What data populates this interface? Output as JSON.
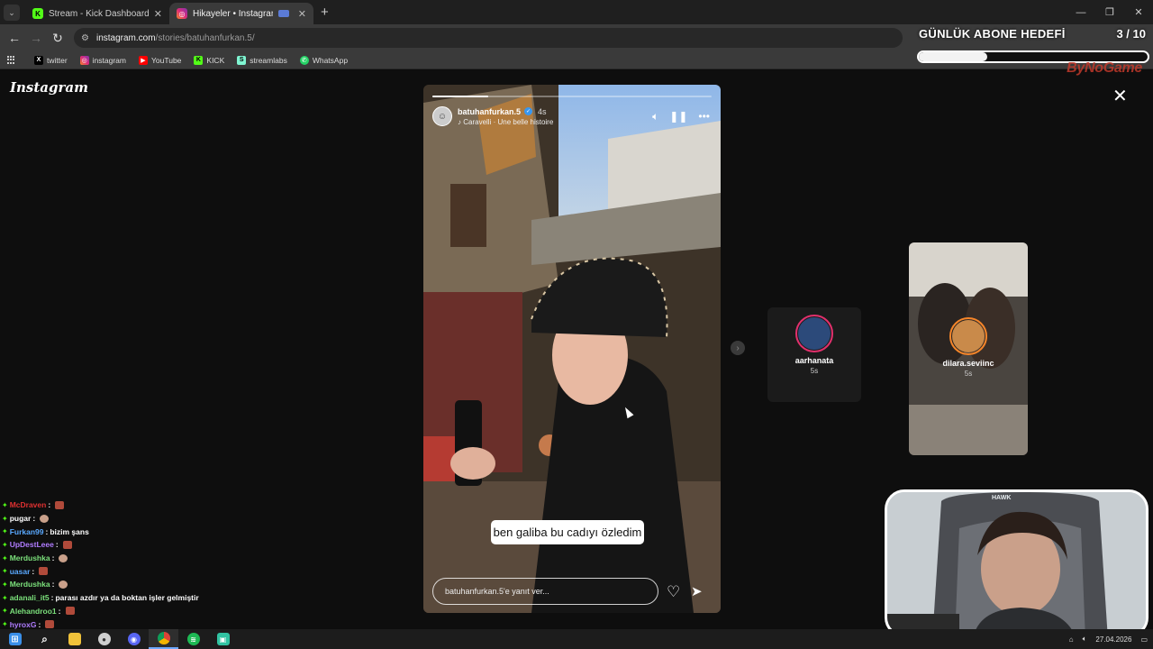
{
  "browser": {
    "tabs": [
      {
        "title": "Stream - Kick Dashboard",
        "active": false,
        "favicon": "kick-icon"
      },
      {
        "title": "Hikayeler • Instagram",
        "active": true,
        "favicon": "instagram-icon"
      }
    ],
    "url_host": "instagram.com",
    "url_path": "/stories/batuhanfurkan.5/",
    "bookmarks": [
      {
        "label": "twitter",
        "icon": "x-icon"
      },
      {
        "label": "instagram",
        "icon": "instagram-icon"
      },
      {
        "label": "YouTube",
        "icon": "youtube-icon"
      },
      {
        "label": "KICK",
        "icon": "kick-icon"
      },
      {
        "label": "streamlabs",
        "icon": "streamlabs-icon"
      },
      {
        "label": "WhatsApp",
        "icon": "whatsapp-icon"
      }
    ]
  },
  "goal": {
    "title": "GÜNLÜK ABONE HEDEFİ",
    "count": "3 / 10",
    "progress": 0.3,
    "brand": "ByNoGame"
  },
  "instagram": {
    "logo": "Instagram",
    "story": {
      "username": "batuhanfurkan.5",
      "time": "4s",
      "music": "Caravelli · Une belle histoire",
      "caption": "ben galiba bu cadıyı özledim",
      "reply_placeholder": "batuhanfurkan.5'e yanıt ver...",
      "progress": 0.2
    },
    "previews": [
      {
        "username": "aarhanata",
        "time": "5s"
      },
      {
        "username": "dilara.seviinc",
        "time": "5s"
      }
    ]
  },
  "chat": [
    {
      "user": "McDraven",
      "color": "#e03131",
      "msg": "",
      "emote": "square"
    },
    {
      "user": "pugar",
      "color": "#ffffff",
      "msg": "",
      "emote": "round"
    },
    {
      "user": "Furkan99",
      "color": "#5aa9ff",
      "msg": "bizim şans",
      "emote": ""
    },
    {
      "user": "UpDestLeee",
      "color": "#b07cff",
      "msg": "",
      "emote": "square"
    },
    {
      "user": "Merdushka",
      "color": "#7be07b",
      "msg": "",
      "emote": "round"
    },
    {
      "user": "uasar",
      "color": "#5aa9ff",
      "msg": "",
      "emote": "square"
    },
    {
      "user": "Merdushka",
      "color": "#7be07b",
      "msg": "",
      "emote": "round"
    },
    {
      "user": "adanali_it5",
      "color": "#7be07b",
      "msg": "parası azdır ya da boktan işler gelmiştir",
      "emote": ""
    },
    {
      "user": "Alehandroo1",
      "color": "#7be07b",
      "msg": "",
      "emote": "square"
    },
    {
      "user": "hyroxG",
      "color": "#b07cff",
      "msg": "",
      "emote": "square"
    }
  ],
  "webcam": {
    "label": "HAWK"
  },
  "taskbar": {
    "date": "27.04.2026"
  },
  "colors": {
    "page_bg": "#0e0e0e",
    "tab_bar": "#1f1f1f",
    "toolbar": "#3a3a3a",
    "goal_brand": "#c0392b"
  }
}
